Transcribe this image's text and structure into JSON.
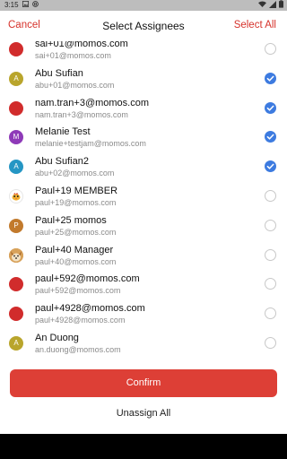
{
  "status_bar": {
    "time": "3:15",
    "icons": [
      "image-icon",
      "at-icon",
      "wifi-icon",
      "signal-icon",
      "battery-icon"
    ]
  },
  "header": {
    "cancel": "Cancel",
    "title": "Select Assignees",
    "select_all": "Select All"
  },
  "accent_color": "#d6322b",
  "check_color": "#3d7be0",
  "members": [
    {
      "avatar": "",
      "avatar_color": "#d12c2c",
      "name": "sai+01@momos.com",
      "email": "sai+01@momos.com",
      "selected": false
    },
    {
      "avatar": "A",
      "avatar_color": "#b9a52c",
      "name": "Abu Sufian",
      "email": "abu+01@momos.com",
      "selected": true
    },
    {
      "avatar": "",
      "avatar_color": "#d12c2c",
      "name": "nam.tran+3@momos.com",
      "email": "nam.tran+3@momos.com",
      "selected": true
    },
    {
      "avatar": "M",
      "avatar_color": "#8e3ab8",
      "name": "Melanie Test",
      "email": "melanie+testjam@momos.com",
      "selected": true
    },
    {
      "avatar": "A",
      "avatar_color": "#2596c4",
      "name": "Abu Sufian2",
      "email": "abu+02@momos.com",
      "selected": true
    },
    {
      "avatar": "bird-image",
      "avatar_color": "#ffffff",
      "name": "Paul+19 MEMBER",
      "email": "paul+19@momos.com",
      "selected": false
    },
    {
      "avatar": "P",
      "avatar_color": "#c27a2c",
      "name": "Paul+25 momos",
      "email": "paul+25@momos.com",
      "selected": false
    },
    {
      "avatar": "dog-image",
      "avatar_color": "#c9893d",
      "name": "Paul+40 Manager",
      "email": "paul+40@momos.com",
      "selected": false
    },
    {
      "avatar": "",
      "avatar_color": "#d12c2c",
      "name": "paul+592@momos.com",
      "email": "paul+592@momos.com",
      "selected": false
    },
    {
      "avatar": "",
      "avatar_color": "#d12c2c",
      "name": "paul+4928@momos.com",
      "email": "paul+4928@momos.com",
      "selected": false
    },
    {
      "avatar": "A",
      "avatar_color": "#b9a52c",
      "name": "An Duong",
      "email": "an.duong@momos.com",
      "selected": false
    }
  ],
  "actions": {
    "confirm": "Confirm",
    "unassign_all": "Unassign All"
  }
}
